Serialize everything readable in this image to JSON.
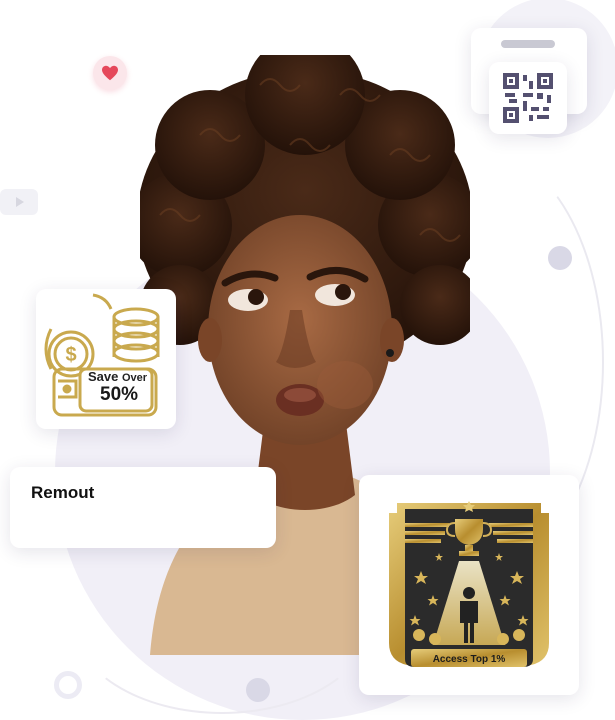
{
  "icons": {
    "heart": "heart-icon",
    "play": "play-icon",
    "qr": "qr-code-icon",
    "coins": "coins-icon",
    "trophy": "trophy-icon"
  },
  "colors": {
    "gold": "#c9a94e",
    "dark": "#2a2a2a",
    "accent_red": "#e5485b",
    "lavender": "#f1eff7"
  },
  "save_badge": {
    "line1": "Save",
    "line1_small": "Over",
    "percent": "50%"
  },
  "name_card": {
    "label": "Remout"
  },
  "access_badge": {
    "label": "Access Top 1%"
  }
}
